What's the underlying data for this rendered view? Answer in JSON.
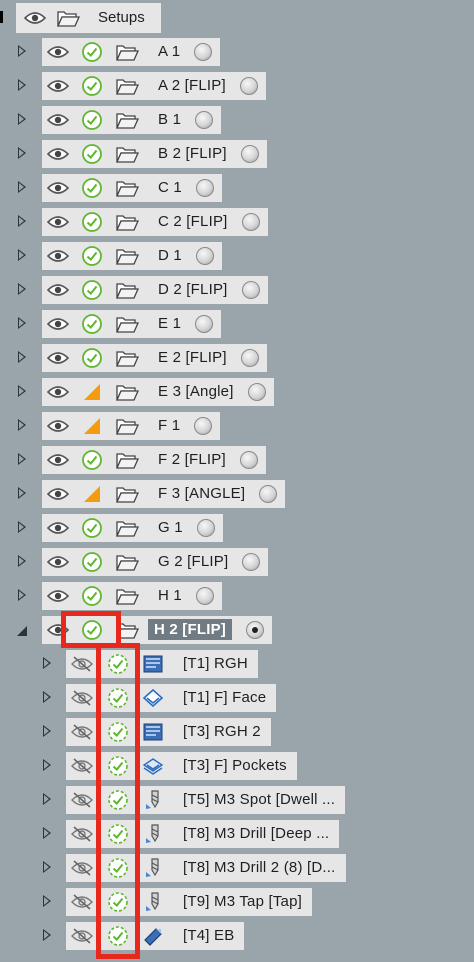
{
  "root": {
    "label": "Setups",
    "eye_icon": "eye-icon",
    "folder_icon": "folder-open-icon"
  },
  "setups": [
    {
      "label": "A 1",
      "status": "check",
      "selected": false,
      "expanded": false
    },
    {
      "label": "A 2 [FLIP]",
      "status": "check",
      "selected": false,
      "expanded": false
    },
    {
      "label": "B 1",
      "status": "check",
      "selected": false,
      "expanded": false
    },
    {
      "label": "B 2 [FLIP]",
      "status": "check",
      "selected": false,
      "expanded": false
    },
    {
      "label": "C 1",
      "status": "check",
      "selected": false,
      "expanded": false
    },
    {
      "label": "C 2 [FLIP]",
      "status": "check",
      "selected": false,
      "expanded": false
    },
    {
      "label": "D 1",
      "status": "check",
      "selected": false,
      "expanded": false
    },
    {
      "label": "D 2 [FLIP]",
      "status": "check",
      "selected": false,
      "expanded": false
    },
    {
      "label": "E 1",
      "status": "check",
      "selected": false,
      "expanded": false
    },
    {
      "label": "E 2 [FLIP]",
      "status": "check",
      "selected": false,
      "expanded": false
    },
    {
      "label": "E 3 [Angle]",
      "status": "warning",
      "selected": false,
      "expanded": false
    },
    {
      "label": "F 1",
      "status": "warning",
      "selected": false,
      "expanded": false
    },
    {
      "label": "F 2 [FLIP]",
      "status": "check",
      "selected": false,
      "expanded": false
    },
    {
      "label": "F 3 [ANGLE]",
      "status": "warning",
      "selected": false,
      "expanded": false
    },
    {
      "label": "G 1",
      "status": "check",
      "selected": false,
      "expanded": false
    },
    {
      "label": "G 2 [FLIP]",
      "status": "check",
      "selected": false,
      "expanded": false
    },
    {
      "label": "H 1",
      "status": "check",
      "selected": false,
      "expanded": false
    },
    {
      "label": "H 2 [FLIP]",
      "status": "check",
      "selected": true,
      "expanded": true
    }
  ],
  "operations": [
    {
      "label": "[T1] RGH",
      "tool_icon": "adaptive-roughing-icon"
    },
    {
      "label": "[T1] F] Face",
      "tool_icon": "face-icon"
    },
    {
      "label": "[T3] RGH 2",
      "tool_icon": "adaptive-roughing-icon"
    },
    {
      "label": "[T3] F] Pockets",
      "tool_icon": "pocket-icon"
    },
    {
      "label": "[T5] M3 Spot [Dwell ...",
      "tool_icon": "drill-icon"
    },
    {
      "label": "[T8] M3 Drill [Deep ...",
      "tool_icon": "drill-icon"
    },
    {
      "label": "[T8] M3 Drill 2 (8) [D...",
      "tool_icon": "drill-icon"
    },
    {
      "label": "[T9] M3 Tap [Tap]",
      "tool_icon": "drill-icon"
    },
    {
      "label": "[T4] EB",
      "tool_icon": "chamfer-icon"
    }
  ],
  "colors": {
    "background": "#9aa4ab",
    "row_bg": "#e6e6e6",
    "check_green": "#5fb630",
    "warning_orange": "#f39c12",
    "highlight_red": "#e8281c",
    "selected_label_bg": "#707b83"
  }
}
